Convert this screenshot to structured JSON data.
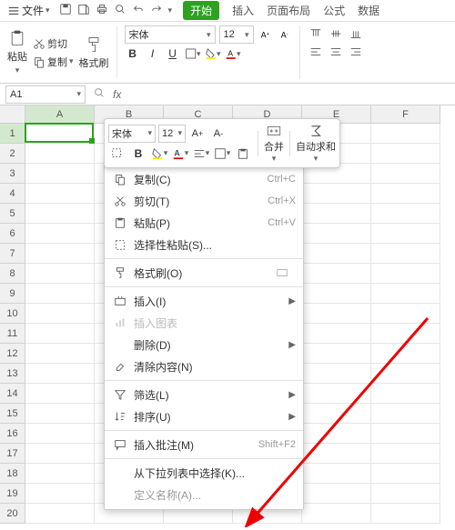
{
  "top": {
    "file": "文件"
  },
  "tabs": {
    "start": "开始",
    "insert": "插入",
    "layout": "页面布局",
    "formula": "公式",
    "data": "数据"
  },
  "ribbon": {
    "paste": "粘贴",
    "cut": "剪切",
    "copy": "复制",
    "fmtpainter": "格式刷",
    "font_name": "宋体",
    "font_size": "12"
  },
  "namebox": "A1",
  "cols": [
    "A",
    "B",
    "C",
    "D",
    "E",
    "F"
  ],
  "float": {
    "font": "宋体",
    "size": "12",
    "merge": "合并",
    "autosum": "自动求和"
  },
  "cm": {
    "copy": "复制(C)",
    "copy_s": "Ctrl+C",
    "cut": "剪切(T)",
    "cut_s": "Ctrl+X",
    "paste": "粘贴(P)",
    "paste_s": "Ctrl+V",
    "pastesp": "选择性粘贴(S)...",
    "fmt": "格式刷(O)",
    "ins": "插入(I)",
    "inschart": "插入图表",
    "del": "删除(D)",
    "clear": "清除内容(N)",
    "filter": "筛选(L)",
    "sort": "排序(U)",
    "comment": "插入批注(M)",
    "comment_s": "Shift+F2",
    "dropdown": "从下拉列表中选择(K)...",
    "defname": "定义名称(A)..."
  }
}
